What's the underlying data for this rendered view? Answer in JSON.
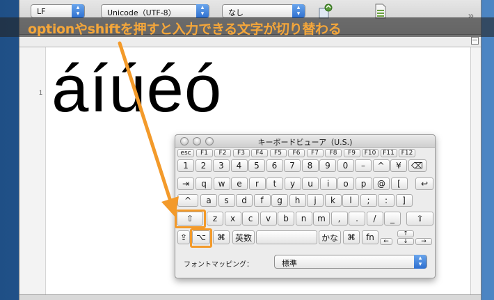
{
  "toolbar": {
    "line_ending": "LF",
    "encoding": "Unicode（UTF-8）",
    "third_popup": "なし"
  },
  "caption": "optionやshiftを押すと入力できる文字が切り替わる",
  "editor": {
    "line_number": "1",
    "content": "áíúéó"
  },
  "keyboard_viewer": {
    "title": "キーボードビューア（U.S.)",
    "fn_row": [
      "esc",
      "F1",
      "F2",
      "F3",
      "F4",
      "F5",
      "F6",
      "F7",
      "F8",
      "F9",
      "F10",
      "F11",
      "F12"
    ],
    "number_row": [
      "1",
      "2",
      "3",
      "4",
      "5",
      "6",
      "7",
      "8",
      "9",
      "0",
      "–",
      "^",
      "¥",
      "⌫"
    ],
    "qwerty_row": [
      "⇥",
      "q",
      "w",
      "e",
      "r",
      "t",
      "y",
      "u",
      "i",
      "o",
      "p",
      "@",
      "[",
      "↩"
    ],
    "home_row": [
      "^",
      "a",
      "s",
      "d",
      "f",
      "g",
      "h",
      "j",
      "k",
      "l",
      ";",
      ":",
      "]"
    ],
    "shift_row": [
      "⇧",
      "z",
      "x",
      "c",
      "v",
      "b",
      "n",
      "m",
      ",",
      ".",
      "/",
      "_",
      "⇧"
    ],
    "bottom_row": [
      "⇪",
      "⌥",
      "⌘",
      "英数",
      "",
      "かな",
      "⌘",
      "fn",
      "←",
      "↑",
      "↓",
      "→"
    ],
    "mapping_label": "フォントマッピング：",
    "mapping_value": "標準"
  },
  "colors": {
    "accent_orange": "#f39a2a",
    "desktop_blue": "#2f6aa8"
  }
}
